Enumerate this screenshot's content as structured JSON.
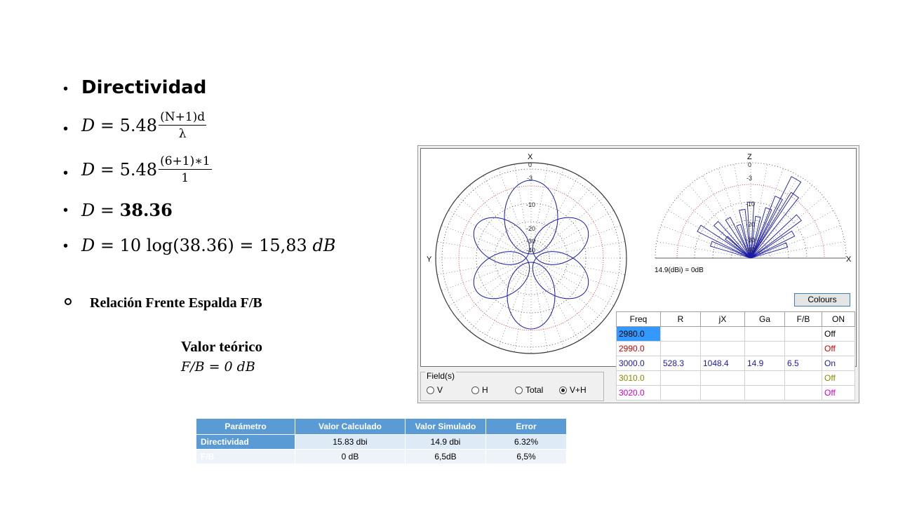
{
  "slide": {
    "heading": "Directividad",
    "eq1": {
      "lhs": "D",
      "eq": "=",
      "coef": "5.48",
      "num": "(N+1)d",
      "den": "λ"
    },
    "eq2": {
      "lhs": "D",
      "eq": "=",
      "coef": "5.48",
      "num": "(6+1)∗1",
      "den": "1"
    },
    "eq3": {
      "lhs": "D",
      "eq": "=",
      "val": "38.36"
    },
    "eq4": {
      "lhs": "D",
      "eq": "=",
      "expr": "10 log(38.36) = 15,83",
      "unit": "dB"
    },
    "relation": "Relación Frente Espalda F/B",
    "theoretical_title": "Valor teórico",
    "theoretical_eq": "F/B = 0 dB"
  },
  "param_table": {
    "headers": [
      "Parámetro",
      "Valor Calculado",
      "Valor Simulado",
      "Error"
    ],
    "rows": [
      [
        "Directividad",
        "15.83 dbi",
        "14.9 dbi",
        "6.32%"
      ],
      [
        "F/B",
        "0 dB",
        "6,5dB",
        "6,5%"
      ]
    ]
  },
  "software": {
    "left_plot": {
      "axis_top": "X",
      "axis_left": "Y",
      "rings": [
        "0",
        "-3",
        "-10",
        "-20",
        "-30",
        "-40"
      ]
    },
    "right_plot": {
      "axis_top": "Z",
      "axis_right": "X",
      "rings": [
        "0",
        "-3",
        "-10",
        "-20",
        "-30",
        "-40"
      ],
      "gain_ref": "14.9(dBi) = 0dB"
    },
    "colours_button": "Colours",
    "freq_table": {
      "headers": [
        "Freq",
        "R",
        "jX",
        "Ga",
        "F/B",
        "ON"
      ],
      "rows": [
        {
          "freq": "2980.0",
          "r": "",
          "jx": "",
          "ga": "",
          "fb": "",
          "on": "Off",
          "color": "#000000",
          "selected": true
        },
        {
          "freq": "2990.0",
          "r": "",
          "jx": "",
          "ga": "",
          "fb": "",
          "on": "Off",
          "color": "#cc0000",
          "selected": false
        },
        {
          "freq": "3000.0",
          "r": "528.3",
          "jx": "1048.4",
          "ga": "14.9",
          "fb": "6.5",
          "on": "On",
          "color": "#1a1aa6",
          "selected": false
        },
        {
          "freq": "3010.0",
          "r": "",
          "jx": "",
          "ga": "",
          "fb": "",
          "on": "Off",
          "color": "#8a8a00",
          "selected": false
        },
        {
          "freq": "3020.0",
          "r": "",
          "jx": "",
          "ga": "",
          "fb": "",
          "on": "Off",
          "color": "#cc00cc",
          "selected": false
        }
      ]
    },
    "fields": {
      "legend": "Field(s)",
      "options": [
        "V",
        "H",
        "Total",
        "V+H"
      ],
      "selected": "V+H"
    }
  },
  "colors": {
    "accent": "#5b9bd5",
    "pattern": "#1a1aa6",
    "grid_red": "#cc2222"
  }
}
